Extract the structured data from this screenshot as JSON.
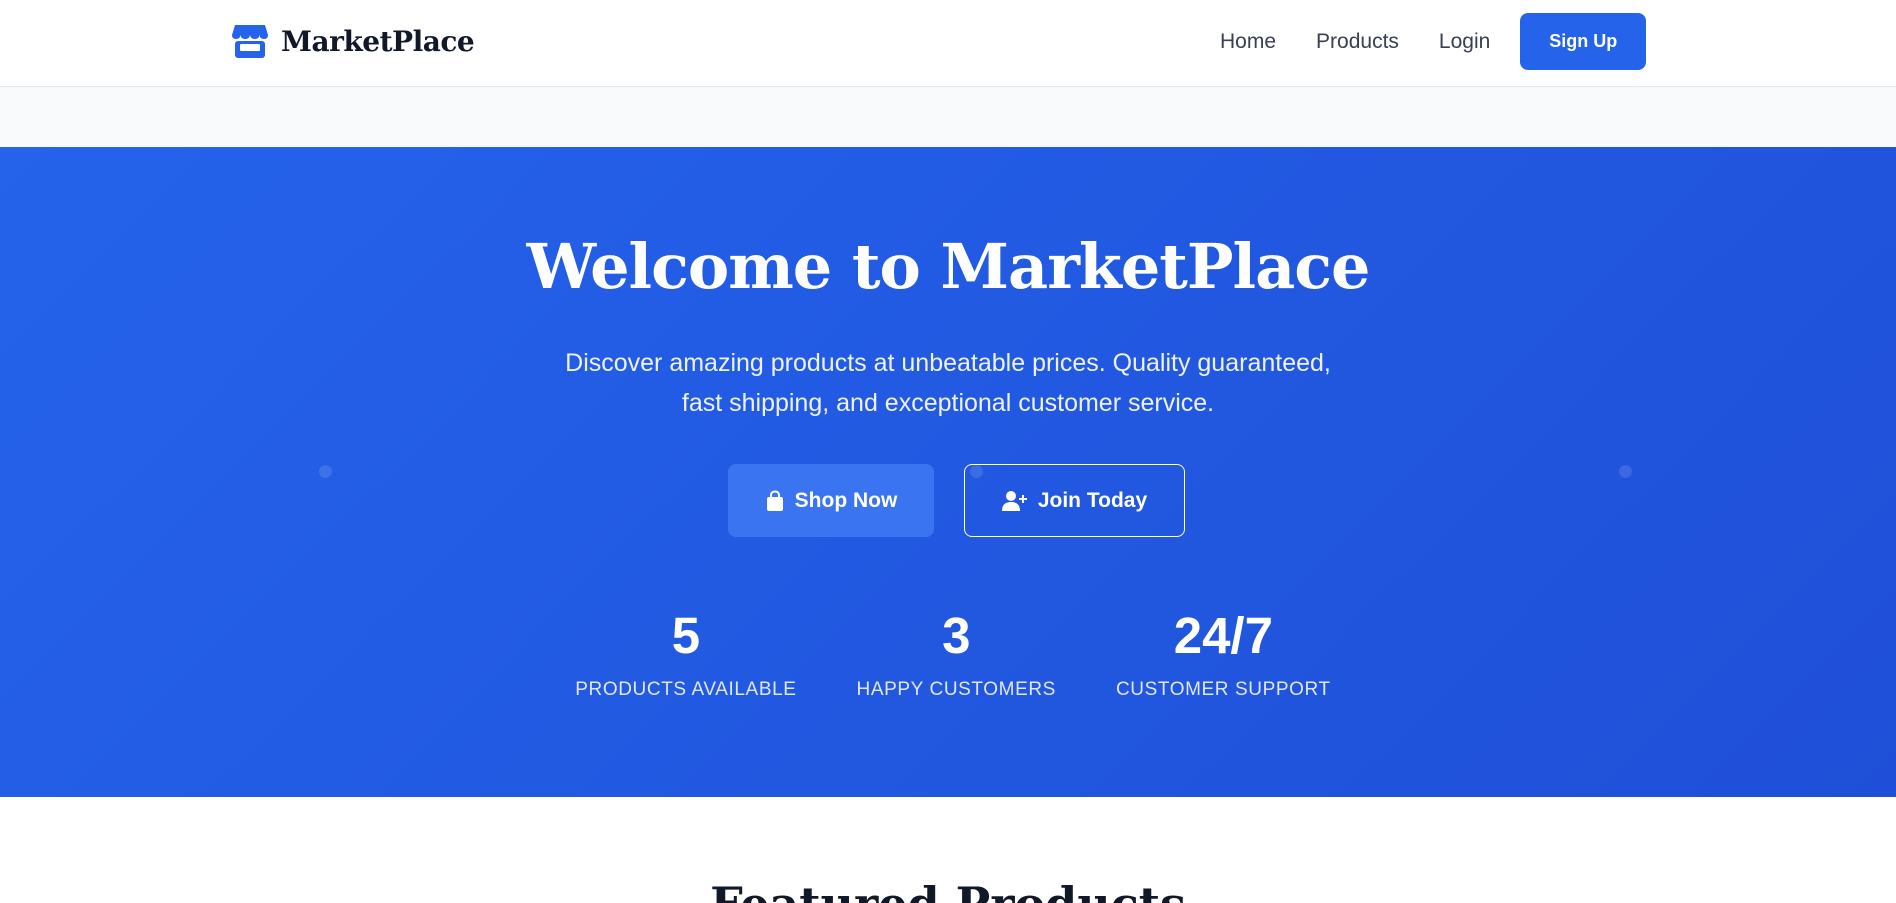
{
  "brand": {
    "name": "MarketPlace",
    "icon": "store-icon",
    "color": "#2563eb"
  },
  "nav": {
    "links": [
      "Home",
      "Products",
      "Login"
    ],
    "signup_label": "Sign Up"
  },
  "hero": {
    "title": "Welcome to MarketPlace",
    "subtitle": "Discover amazing products at unbeatable prices. Quality guaranteed, fast shipping, and exceptional customer service.",
    "shop_label": "Shop Now",
    "shop_icon": "shopping-bag-icon",
    "join_label": "Join Today",
    "join_icon": "user-plus-icon",
    "background": "#2563eb"
  },
  "stats": [
    {
      "value": "5",
      "label": "PRODUCTS AVAILABLE"
    },
    {
      "value": "3",
      "label": "HAPPY CUSTOMERS"
    },
    {
      "value": "24/7",
      "label": "CUSTOMER SUPPORT"
    }
  ],
  "featured": {
    "title": "Featured Products"
  }
}
